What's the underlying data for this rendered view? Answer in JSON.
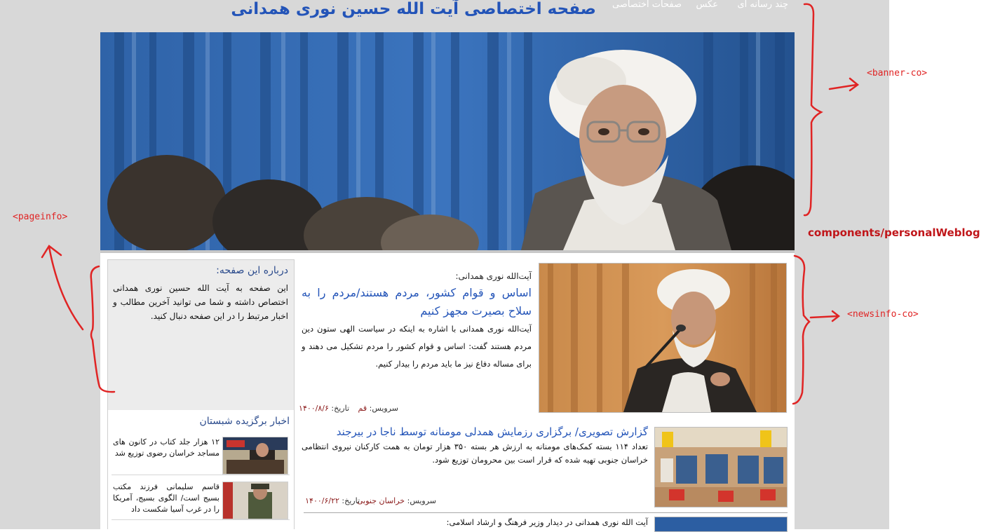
{
  "header": {
    "title": "صفحه اختصاصی آیت الله حسین نوری همدانی",
    "nav": [
      "چند رسانه ای",
      "عکس",
      "صفحات اختصاصی"
    ]
  },
  "about": {
    "title": "درباره این صفحه:",
    "text": "این صفحه به آیت الله حسین نوری همدانی اختصاص داشته و شما می توانید آخرین مطالب و اخبار مرتبط را در این صفحه دنبال کنید."
  },
  "picks": {
    "title": "اخبار برگزیده شبستان",
    "items": [
      {
        "text": "۱۲ هزار جلد کتاب در کانون های مساجد خراسان رضوی توزیع شد"
      },
      {
        "text": "قاسم سلیمانی فرزند مکتب بسیج است/ الگوی بسیج، آمریکا را در غرب آسیا شکست داد"
      }
    ]
  },
  "featured": {
    "kicker": "آیت‌الله نوری همدانی:",
    "title": "اساس و قوام کشور، مردم هستند/مردم را به سلاح بصیرت مجهز کنیم",
    "summary": "آیت‌الله نوری همدانی با اشاره به اینکه در سیاست الهی ستون دین مردم هستند گفت: اساس و قوام کشور را مردم تشکیل می دهند و برای مساله دفاع نیز ما باید مردم را بیدار کنیم.",
    "service_label": "سرویس:",
    "service": "قم",
    "date_label": "تاریخ:",
    "date": "۱۴۰۰/۸/۶"
  },
  "news2": {
    "title": "گزارش تصویری/ برگزاری رزمایش همدلی مومنانه توسط ناجا در بیرجند",
    "summary": "تعداد ۱۱۴ بسته کمک‌های مومنانه به ارزش هر بسته ۳۵۰ هزار تومان به همت کارکنان نیروی انتظامی خراسان جنوبی تهیه شده که قرار است بین محرومان توزیع شود.",
    "service_label": "سرویس:",
    "service": "خراسان جنوبی",
    "date_label": "تاریخ:",
    "date": "۱۴۰۰/۶/۲۲"
  },
  "news3": {
    "kicker": "آیت الله نوری همدانی در دیدار وزیر فرهنگ و ارشاد اسلامی:"
  },
  "annotations": {
    "banner": "<banner-co>",
    "pageinfo": "<pageinfo>",
    "newsinfo": "<newsinfo-co>",
    "component": "components/personalWeblog"
  },
  "colors": {
    "title_blue": "#2354b8",
    "annotation_red": "#e02424",
    "page_gray": "#d8d8d8"
  }
}
